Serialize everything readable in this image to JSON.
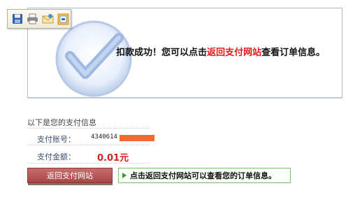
{
  "success": {
    "msg_prefix": "扣款成功！您可以点击",
    "msg_link": "返回支付网站",
    "msg_suffix": "查看订单信息。"
  },
  "toolbar": {
    "icons": [
      "save-icon",
      "print-icon",
      "mail-icon",
      "export-icon"
    ]
  },
  "payment_info": {
    "section_title": "以下是您的支付信息",
    "account_label": "支付账号：",
    "account_value": "4340614",
    "amount_label": "支付金额：",
    "amount_value": "0.01元"
  },
  "actions": {
    "return_button_label": "返回支付网站",
    "tip_text": "点击返回支付网站可以查看您的订单信息。"
  },
  "colors": {
    "highlight": "#e4181c",
    "button": "#b04c4c",
    "tip_border": "#7ac06f",
    "redaction": "#f26b2a"
  }
}
